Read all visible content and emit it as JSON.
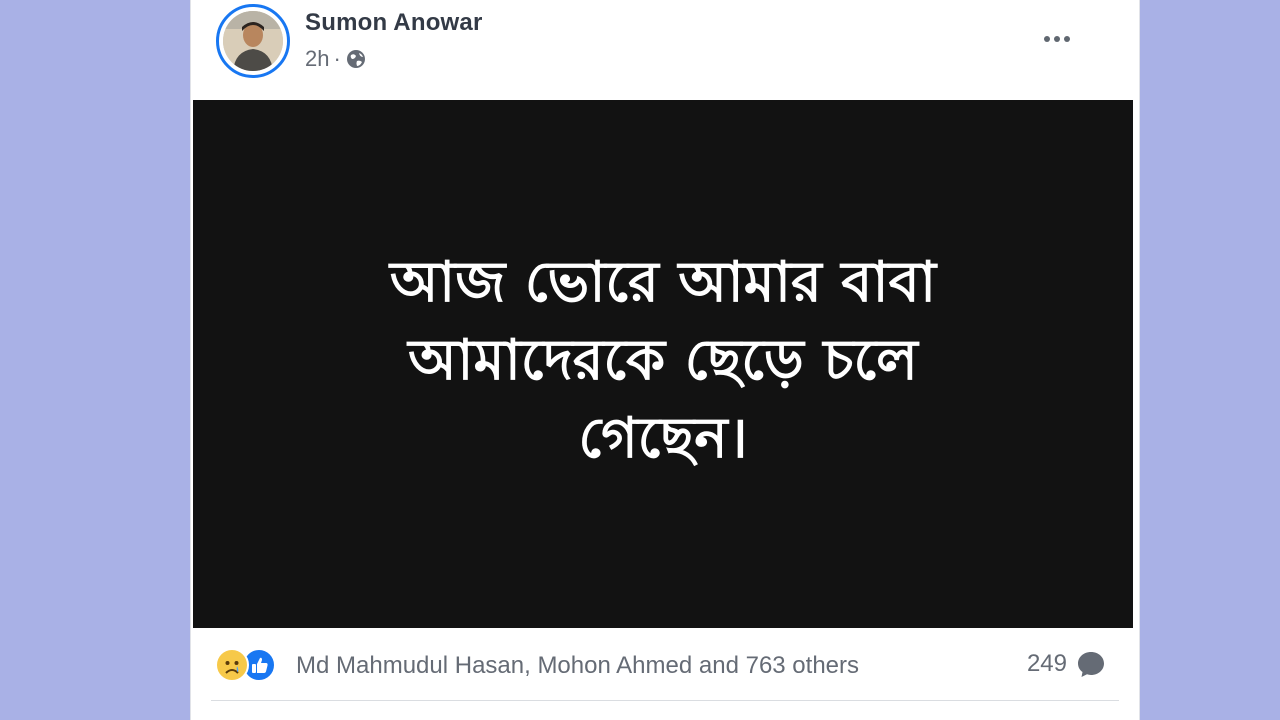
{
  "post": {
    "author_name": "Sumon Anowar",
    "timestamp": "2h",
    "separator": "·",
    "privacy_icon": "globe-icon",
    "more_icon": "more-options-icon",
    "image_text_lines": [
      "আজ ভোরে আমার বাবা",
      "আমাদেরকে ছেড়ে চলে",
      "গেছেন।"
    ],
    "image_background": "#121212"
  },
  "reactions": {
    "icons": [
      "sad-reaction-icon",
      "like-reaction-icon"
    ],
    "reactors_text": "Md Mahmudul Hasan, Mohon Ahmed and 763 others",
    "comment_count": "249",
    "comment_icon": "comment-bubble-icon"
  },
  "colors": {
    "page_background": "#a9b1e6",
    "accent": "#1877f2",
    "text_primary": "#333a46",
    "text_secondary": "#656b75"
  }
}
